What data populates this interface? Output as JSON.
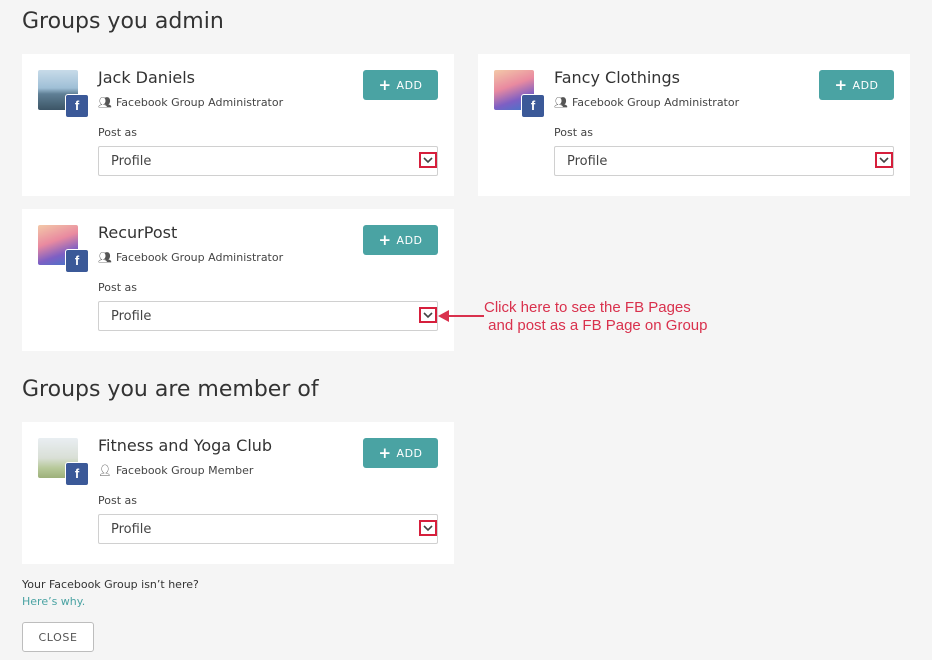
{
  "admin_section": {
    "title": "Groups you admin",
    "groups": [
      {
        "name": "Jack Daniels",
        "role": "Facebook Group Administrator",
        "post_as_label": "Post as",
        "post_as_value": "Profile",
        "add_label": "ADD",
        "avatar": "lake-landscape",
        "badge": "f"
      },
      {
        "name": "Fancy Clothings",
        "role": "Facebook Group Administrator",
        "post_as_label": "Post as",
        "post_as_value": "Profile",
        "add_label": "ADD",
        "avatar": "flower-bouquet",
        "badge": "f"
      },
      {
        "name": "RecurPost",
        "role": "Facebook Group Administrator",
        "post_as_label": "Post as",
        "post_as_value": "Profile",
        "add_label": "ADD",
        "avatar": "flower-bouquet",
        "badge": "f"
      }
    ]
  },
  "member_section": {
    "title": "Groups you are member of",
    "groups": [
      {
        "name": "Fitness and Yoga Club",
        "role": "Facebook Group Member",
        "post_as_label": "Post as",
        "post_as_value": "Profile",
        "add_label": "ADD",
        "avatar": "girl-balloons",
        "badge": "f"
      }
    ]
  },
  "annotation": {
    "text": "Click here to see the FB Pages\n and post as a FB Page on Group",
    "color": "#d9314d"
  },
  "footer": {
    "not_here": "Your Facebook Group isn’t here?",
    "why_link": "Here’s why.",
    "close_label": "CLOSE"
  },
  "colors": {
    "accent": "#4aa3a3",
    "facebook": "#3b5998",
    "highlight": "#d61f3c"
  }
}
